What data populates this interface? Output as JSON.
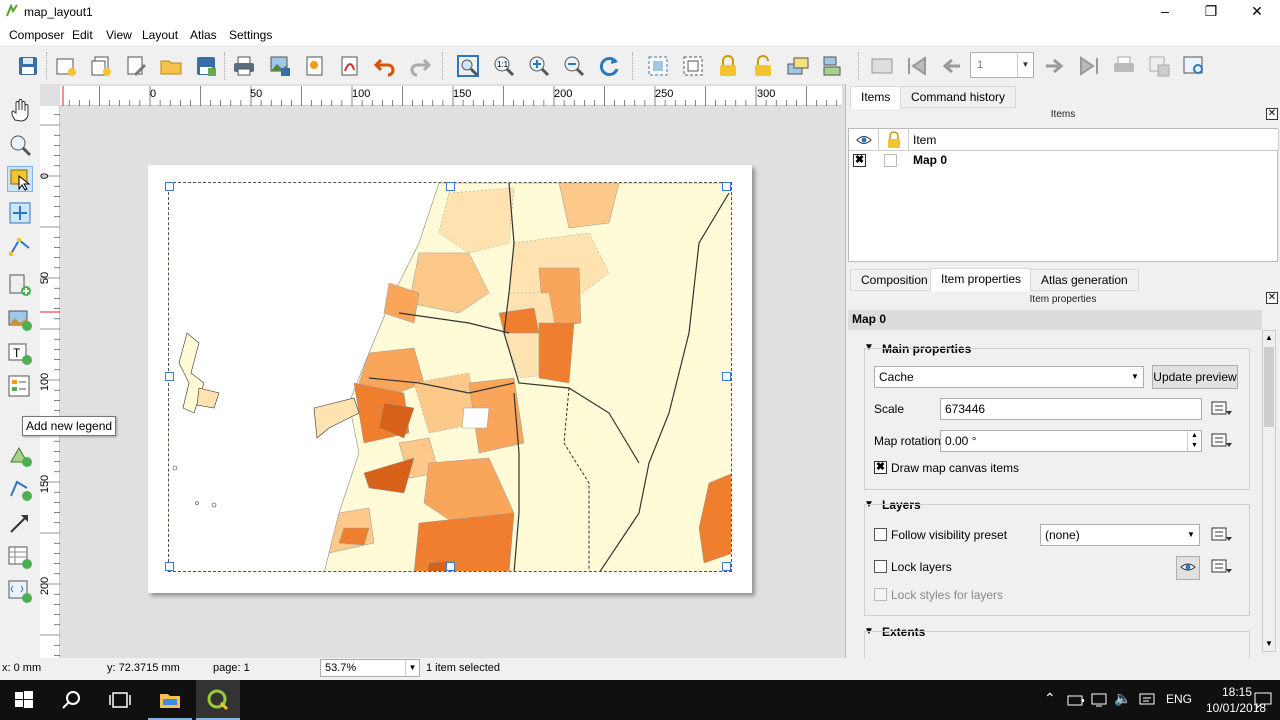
{
  "window": {
    "title": "map_layout1"
  },
  "menu": [
    "Composer",
    "Edit",
    "View",
    "Layout",
    "Atlas",
    "Settings"
  ],
  "toolbar": {
    "page_number": "1"
  },
  "ruler": {
    "h_labels": [
      "0",
      "50",
      "100",
      "150",
      "200",
      "250",
      "300"
    ],
    "v_labels": [
      "0",
      "50",
      "100",
      "150",
      "200"
    ]
  },
  "tooltip": "Add new legend",
  "right_panel": {
    "top_tabs": [
      "Items",
      "Command history"
    ],
    "items_title": "Items",
    "items_columns": {
      "item": "Item"
    },
    "items_rows": [
      {
        "name": "Map 0",
        "visible": true,
        "locked": false
      }
    ],
    "bottom_tabs": [
      "Composition",
      "Item properties",
      "Atlas generation"
    ],
    "props_title": "Item properties",
    "item_header": "Map 0",
    "main_properties": {
      "title": "Main properties",
      "cache_mode": "Cache",
      "update_preview": "Update preview",
      "scale_label": "Scale",
      "scale_value": "673446",
      "rotation_label": "Map rotation",
      "rotation_value": "0.00 °",
      "draw_items_label": "Draw map canvas items",
      "draw_items_checked": true
    },
    "layers": {
      "title": "Layers",
      "follow_preset_label": "Follow visibility preset",
      "preset_value": "(none)",
      "lock_layers_label": "Lock layers",
      "lock_styles_label": "Lock styles for layers"
    },
    "extents": {
      "title": "Extents"
    }
  },
  "status": {
    "x": "x: 0 mm",
    "y": "y: 72.3715 mm",
    "page": "page: 1",
    "zoom": "53.7%",
    "selection": "1 item selected"
  },
  "taskbar": {
    "lang": "ENG",
    "time": "18:15",
    "date": "10/01/2018"
  },
  "colors": {
    "choropleth": [
      "#fffbd6",
      "#fee3b0",
      "#fdc98a",
      "#f9a55a",
      "#ef7e2f",
      "#d8611a"
    ],
    "accent": "#3a7bd5"
  }
}
